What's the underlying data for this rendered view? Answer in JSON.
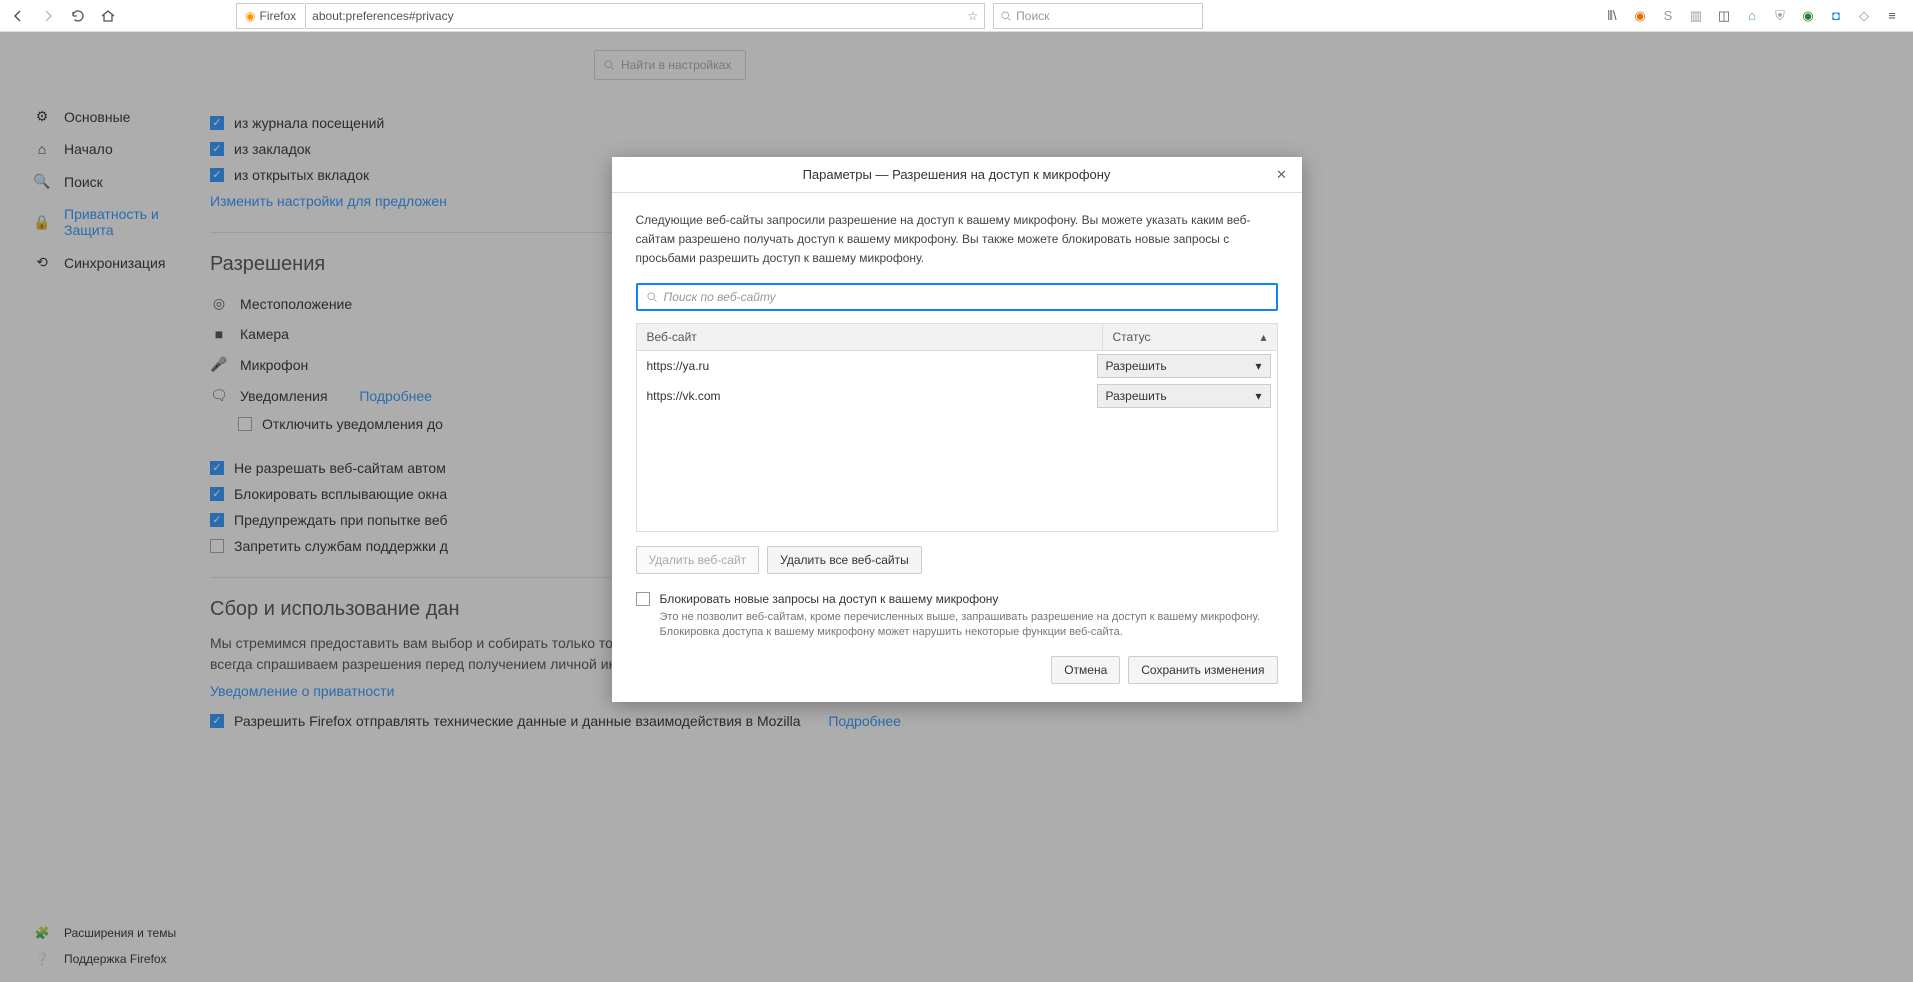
{
  "toolbar": {
    "identity": "Firefox",
    "url": "about:preferences#privacy",
    "search_placeholder": "Поиск"
  },
  "sidebar": {
    "items": [
      {
        "label": "Основные"
      },
      {
        "label": "Начало"
      },
      {
        "label": "Поиск"
      },
      {
        "label": "Приватность и Защита"
      },
      {
        "label": "Синхронизация"
      }
    ],
    "bottom": [
      {
        "label": "Расширения и темы"
      },
      {
        "label": "Поддержка Firefox"
      }
    ]
  },
  "prefs": {
    "search_placeholder": "Найти в настройках",
    "addr_history": "из журнала посещений",
    "addr_bookmarks": "из закладок",
    "addr_tabs": "из открытых вкладок",
    "change_suggestions": "Изменить настройки для предложен",
    "permissions_title": "Разрешения",
    "perm_location": "Местоположение",
    "perm_camera": "Камера",
    "perm_microphone": "Микрофон",
    "perm_notifications": "Уведомления",
    "perm_more": "Подробнее",
    "perm_disable_notif": "Отключить уведомления до",
    "block_autoplay": "Не разрешать веб-сайтам автом",
    "block_popups": "Блокировать всплывающие окна",
    "warn_install": "Предупреждать при попытке веб",
    "block_a11y": "Запретить службам поддержки д",
    "data_title": "Сбор и использование дан",
    "data_desc1": "Мы стремимся предоставить вам выбор и собирать только то, что нам нужно, для выпуска и улучшения Firefox для всех и каждого. Мы всегда спрашиваем разрешения перед получением личной информации.",
    "privacy_link": "Уведомление о приватности",
    "telemetry": "Разрешить Firefox отправлять технические данные и данные взаимодействия в Mozilla",
    "telemetry_more": "Подробнее"
  },
  "dialog": {
    "title": "Параметры — Разрешения на доступ к микрофону",
    "desc": "Следующие веб-сайты запросили разрешение на доступ к вашему микрофону. Вы можете указать каким веб-сайтам разрешено получать доступ к вашему микрофону. Вы также можете блокировать новые запросы с просьбами разрешить доступ к вашему микрофону.",
    "search_placeholder": "Поиск по веб-сайту",
    "col_site": "Веб-сайт",
    "col_status": "Статус",
    "rows": [
      {
        "site": "https://ya.ru",
        "status": "Разрешить"
      },
      {
        "site": "https://vk.com",
        "status": "Разрешить"
      }
    ],
    "remove_site": "Удалить веб-сайт",
    "remove_all": "Удалить все веб-сайты",
    "block_new": "Блокировать новые запросы на доступ к вашему микрофону",
    "block_new_desc": "Это не позволит веб-сайтам, кроме перечисленных выше, запрашивать разрешение на доступ к вашему микрофону. Блокировка доступа к вашему микрофону может нарушить некоторые функции веб-сайта.",
    "cancel": "Отмена",
    "save": "Сохранить изменения"
  }
}
